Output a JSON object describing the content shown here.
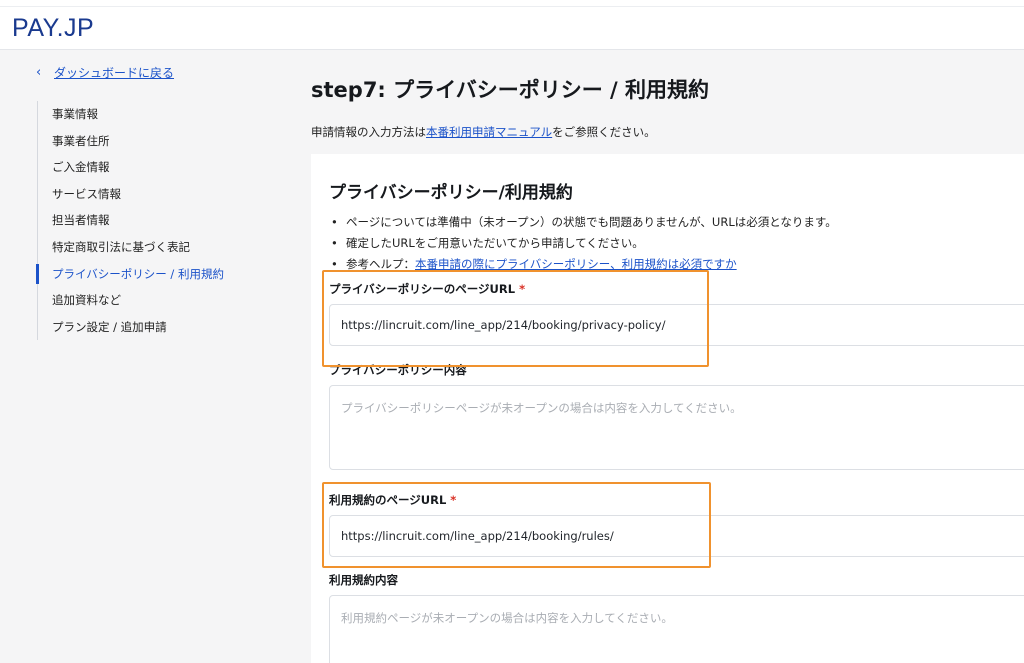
{
  "brand": {
    "logo_main": "PAY",
    "logo_sep": ".",
    "logo_tail": "JP"
  },
  "back": {
    "label": "ダッシュボードに戻る"
  },
  "sidebar": {
    "items": [
      {
        "label": "事業情報"
      },
      {
        "label": "事業者住所"
      },
      {
        "label": "ご入金情報"
      },
      {
        "label": "サービス情報"
      },
      {
        "label": "担当者情報"
      },
      {
        "label": "特定商取引法に基づく表記"
      },
      {
        "label": "プライバシーポリシー / 利用規約"
      },
      {
        "label": "追加資料など"
      },
      {
        "label": "プラン設定 / 追加申請"
      }
    ],
    "active_index": 6
  },
  "main": {
    "title": "step7: プライバシーポリシー / 利用規約",
    "intro_prefix": "申請情報の入力方法は",
    "intro_link": "本番利用申請マニュアル",
    "intro_suffix": "をご参照ください。"
  },
  "card": {
    "title": "プライバシーポリシー/利用規約",
    "bullets": [
      {
        "text": "ページについては準備中（未オープン）の状態でも問題ありませんが、URLは必須となります。"
      },
      {
        "text": "確定したURLをご用意いただいてから申請してください。"
      },
      {
        "text": "参考ヘルプ：",
        "link": "本番申請の際にプライバシーポリシー、利用規約は必須ですか"
      }
    ],
    "fields": {
      "privacy_url": {
        "label": "プライバシーポリシーのページURL",
        "required": "*",
        "value": "https://lincruit.com/line_app/214/booking/privacy-policy/"
      },
      "privacy_content": {
        "label": "プライバシーポリシー内容",
        "placeholder": "プライバシーポリシーページが未オープンの場合は内容を入力してください。"
      },
      "terms_url": {
        "label": "利用規約のページURL",
        "required": "*",
        "value": "https://lincruit.com/line_app/214/booking/rules/"
      },
      "terms_content": {
        "label": "利用規約内容",
        "placeholder": "利用規約ページが未オープンの場合は内容を入力してください。"
      }
    }
  },
  "colors": {
    "accent": "#1b52c9",
    "highlight": "#f0922e",
    "required": "#d93025",
    "logo": "#1a3a8f"
  }
}
